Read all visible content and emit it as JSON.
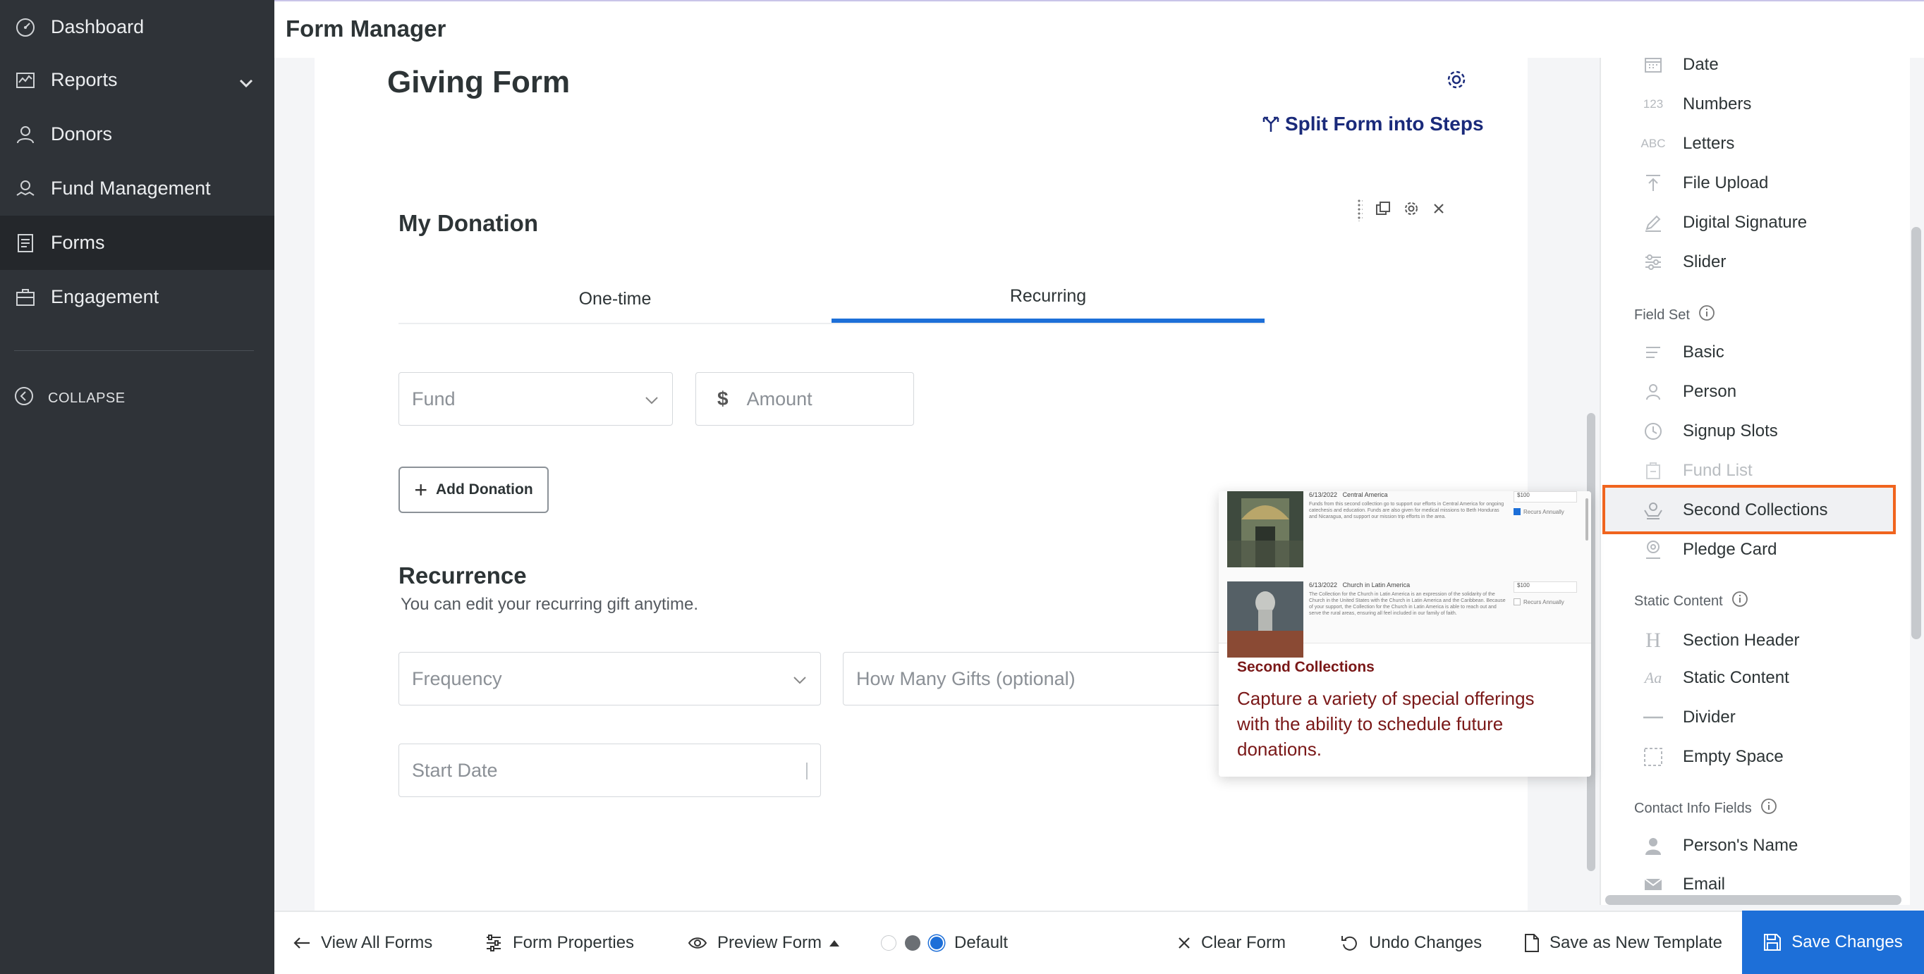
{
  "sidebar": {
    "items": [
      {
        "label": "Dashboard",
        "icon": "dashboard-icon"
      },
      {
        "label": "Reports",
        "icon": "reports-icon"
      },
      {
        "label": "Donors",
        "icon": "person-icon"
      },
      {
        "label": "Fund Management",
        "icon": "fund-icon"
      },
      {
        "label": "Forms",
        "icon": "forms-icon",
        "active": true
      },
      {
        "label": "Engagement",
        "icon": "engagement-icon"
      }
    ],
    "collapse_label": "COLLAPSE"
  },
  "header": {
    "title": "Form Manager"
  },
  "form": {
    "title": "Giving Form",
    "split_label": "Split Form into Steps",
    "donation_title": "My Donation",
    "tabs": [
      "One-time",
      "Recurring"
    ],
    "active_tab": "Recurring",
    "fund_placeholder": "Fund",
    "amount_symbol": "$",
    "amount_placeholder": "Amount",
    "add_donation_label": "Add Donation",
    "recurrence_title": "Recurrence",
    "recurrence_subtitle": "You can edit your recurring gift anytime.",
    "frequency_placeholder": "Frequency",
    "gifts_placeholder": "How Many Gifts  (optional)",
    "start_date_placeholder": "Start Date"
  },
  "palette": {
    "basic_items": [
      {
        "label": "Date",
        "icon": "calendar-icon"
      },
      {
        "label": "Numbers",
        "icon": "123"
      },
      {
        "label": "Letters",
        "icon": "ABC"
      },
      {
        "label": "File Upload",
        "icon": "upload-icon"
      },
      {
        "label": "Digital Signature",
        "icon": "pen-icon"
      },
      {
        "label": "Slider",
        "icon": "slider-icon"
      }
    ],
    "field_set_heading": "Field Set",
    "field_set_items": [
      {
        "label": "Basic",
        "icon": "lines-icon"
      },
      {
        "label": "Person",
        "icon": "person-icon"
      },
      {
        "label": "Signup Slots",
        "icon": "clock-icon"
      },
      {
        "label": "Fund List",
        "icon": "fund-list-icon",
        "disabled": true
      },
      {
        "label": "Second Collections",
        "icon": "collections-icon",
        "highlighted": true
      },
      {
        "label": "Pledge Card",
        "icon": "pledge-icon"
      }
    ],
    "static_heading": "Static Content",
    "static_items": [
      {
        "label": "Section Header",
        "icon": "H"
      },
      {
        "label": "Static Content",
        "icon": "Aa"
      },
      {
        "label": "Divider",
        "icon": "divider-icon"
      },
      {
        "label": "Empty Space",
        "icon": "empty-space-icon"
      }
    ],
    "contact_heading": "Contact Info Fields",
    "contact_items": [
      {
        "label": "Person's Name",
        "icon": "person-solid-icon"
      },
      {
        "label": "Email",
        "icon": "envelope-icon"
      }
    ]
  },
  "popover": {
    "preview_rows": [
      {
        "date": "6/13/2022",
        "name": "Central America",
        "amount": "$100",
        "check_label": "Recurs Annually",
        "checked": true
      },
      {
        "date": "6/13/2022",
        "name": "Church in Latin America",
        "amount": "$100",
        "check_label": "Recurs Annually",
        "checked": false
      }
    ],
    "title": "Second Collections",
    "description": "Capture a variety of special offerings with the ability to schedule future donations."
  },
  "bottombar": {
    "view_all": "View All Forms",
    "properties": "Form Properties",
    "preview": "Preview Form",
    "theme": "Default",
    "clear": "Clear Form",
    "undo": "Undo Changes",
    "save_template": "Save as New Template",
    "save": "Save Changes"
  },
  "colors": {
    "accent": "#1d6fd8",
    "sidebar_bg": "#2f3338",
    "highlight_border": "#f0641e",
    "popover_text": "#7a1818"
  }
}
